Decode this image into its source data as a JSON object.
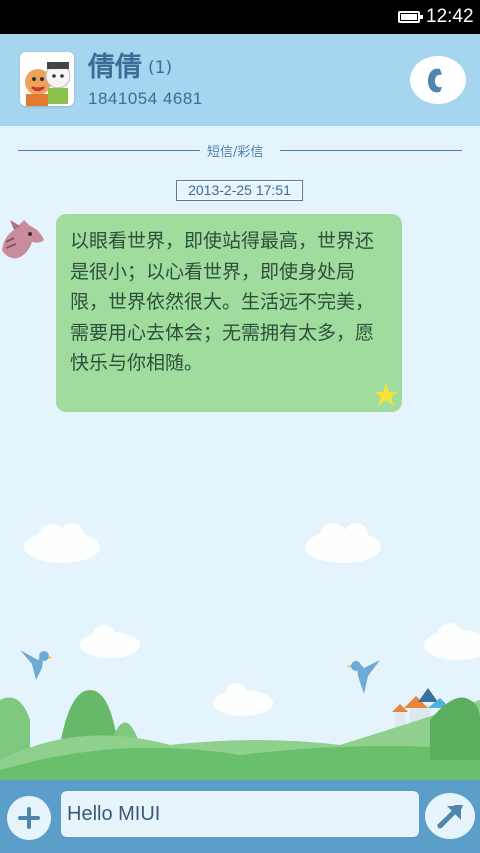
{
  "status_bar": {
    "time": "12:42",
    "icons": [
      "battery-icon"
    ]
  },
  "header": {
    "contact_name": "倩倩",
    "message_count": "(1)",
    "phone_number": "1841054 4681",
    "icons": [
      "avatar",
      "phone-call-icon"
    ]
  },
  "thread": {
    "divider_label": "短信/彩信",
    "timestamp": "2013-2-25 17:51",
    "messages": [
      {
        "text": "以眼看世界，即使站得最高，世界还是很小；以心看世界，即使身处局限，世界依然很大。生活远不完美，需要用心去体会；无需拥有太多，愿快乐与你相随。"
      }
    ]
  },
  "compose": {
    "input_value": "Hello MIUI",
    "icons": [
      "add-icon",
      "send-icon"
    ]
  },
  "colors": {
    "header_bg": "#a6d5f0",
    "bubble_bg": "#9fdc9e",
    "accent_text": "#3d6d94",
    "input_bar_bg": "#5a9ec9"
  }
}
